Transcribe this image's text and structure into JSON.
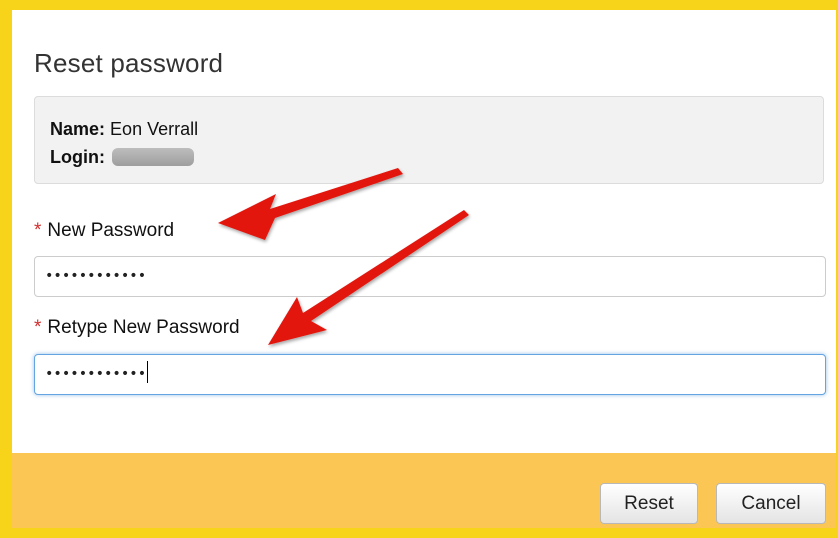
{
  "dialog": {
    "title": "Reset password",
    "info": {
      "name_label": "Name:",
      "name_value": "Eon Verrall",
      "login_label": "Login:"
    },
    "fields": {
      "new_password_required_mark": "*",
      "new_password_label": "New Password",
      "new_password_value": "••••••••••••",
      "retype_required_mark": "*",
      "retype_label": "Retype New Password",
      "retype_value": "••••••••••••"
    },
    "buttons": {
      "reset": "Reset",
      "cancel": "Cancel"
    }
  },
  "colors": {
    "frame": "#f7d41a",
    "footer": "#fbc654",
    "required": "#d32f2f",
    "annotation_arrow": "#e3150f",
    "focus_border": "#64a4e0"
  }
}
